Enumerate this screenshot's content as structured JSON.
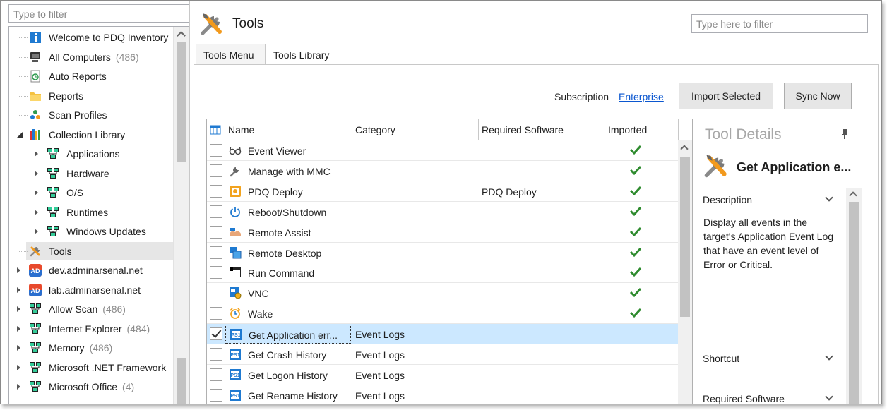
{
  "left_panel": {
    "filter_placeholder": "Type to filter",
    "tree": [
      {
        "label": "Welcome to PDQ Inventory",
        "count": "",
        "icon": "info-icon",
        "level": 1,
        "expander": ""
      },
      {
        "label": "All Computers",
        "count": "(486)",
        "icon": "computer-icon",
        "level": 1,
        "expander": ""
      },
      {
        "label": "Auto Reports",
        "count": "",
        "icon": "auto-report-icon",
        "level": 1,
        "expander": ""
      },
      {
        "label": "Reports",
        "count": "",
        "icon": "folder-icon",
        "level": 1,
        "expander": ""
      },
      {
        "label": "Scan Profiles",
        "count": "",
        "icon": "scan-profiles-icon",
        "level": 1,
        "expander": ""
      },
      {
        "label": "Collection Library",
        "count": "",
        "icon": "library-icon",
        "level": 1,
        "expander": "open"
      },
      {
        "label": "Applications",
        "count": "",
        "icon": "collection-icon",
        "level": 2,
        "expander": "closed"
      },
      {
        "label": "Hardware",
        "count": "",
        "icon": "collection-icon",
        "level": 2,
        "expander": "closed"
      },
      {
        "label": "O/S",
        "count": "",
        "icon": "collection-icon",
        "level": 2,
        "expander": "closed"
      },
      {
        "label": "Runtimes",
        "count": "",
        "icon": "collection-icon",
        "level": 2,
        "expander": "closed"
      },
      {
        "label": "Windows Updates",
        "count": "",
        "icon": "collection-icon",
        "level": 2,
        "expander": "closed"
      },
      {
        "label": "Tools",
        "count": "",
        "icon": "tools-icon",
        "level": 1,
        "expander": "",
        "selected": true
      },
      {
        "label": "dev.adminarsenal.net",
        "count": "",
        "icon": "ad-icon",
        "level": 1,
        "expander": "closed"
      },
      {
        "label": "lab.adminarsenal.net",
        "count": "",
        "icon": "ad-icon",
        "level": 1,
        "expander": "closed"
      },
      {
        "label": "Allow Scan",
        "count": "(486)",
        "icon": "collection-icon",
        "level": 1,
        "expander": "closed"
      },
      {
        "label": "Internet Explorer",
        "count": "(484)",
        "icon": "collection-icon",
        "level": 1,
        "expander": "closed"
      },
      {
        "label": "Memory",
        "count": "(486)",
        "icon": "collection-icon",
        "level": 1,
        "expander": "closed"
      },
      {
        "label": "Microsoft .NET Framework",
        "count": "",
        "icon": "collection-icon",
        "level": 1,
        "expander": "closed"
      },
      {
        "label": "Microsoft Office",
        "count": "(4)",
        "icon": "collection-icon",
        "level": 1,
        "expander": "closed"
      }
    ]
  },
  "header": {
    "title": "Tools",
    "filter_placeholder": "Type here to filter"
  },
  "tabs": [
    {
      "label": "Tools Menu",
      "active": false
    },
    {
      "label": "Tools Library",
      "active": true
    }
  ],
  "subscription": {
    "label": "Subscription",
    "value": "Enterprise"
  },
  "buttons": {
    "import_selected": "Import Selected",
    "sync_now": "Sync Now"
  },
  "grid": {
    "columns": [
      "Name",
      "Category",
      "Required Software",
      "Imported"
    ],
    "rows": [
      {
        "checked": false,
        "icon": "glasses-icon",
        "name": "Event Viewer",
        "category": "",
        "required": "",
        "imported": true
      },
      {
        "checked": false,
        "icon": "wrench-icon",
        "name": "Manage with MMC",
        "category": "",
        "required": "",
        "imported": true
      },
      {
        "checked": false,
        "icon": "pdq-deploy-icon",
        "name": "PDQ Deploy",
        "category": "",
        "required": "PDQ Deploy",
        "imported": true
      },
      {
        "checked": false,
        "icon": "power-icon",
        "name": "Reboot/Shutdown",
        "category": "",
        "required": "",
        "imported": true
      },
      {
        "checked": false,
        "icon": "remote-assist-icon",
        "name": "Remote Assist",
        "category": "",
        "required": "",
        "imported": true
      },
      {
        "checked": false,
        "icon": "remote-desktop-icon",
        "name": "Remote Desktop",
        "category": "",
        "required": "",
        "imported": true
      },
      {
        "checked": false,
        "icon": "console-icon",
        "name": "Run Command",
        "category": "",
        "required": "",
        "imported": true
      },
      {
        "checked": false,
        "icon": "vnc-icon",
        "name": "VNC",
        "category": "",
        "required": "",
        "imported": true
      },
      {
        "checked": false,
        "icon": "alarm-clock-icon",
        "name": "Wake",
        "category": "",
        "required": "",
        "imported": true
      },
      {
        "checked": true,
        "icon": "powershell-icon",
        "name": "Get Application err...",
        "category": "Event Logs",
        "required": "",
        "imported": false,
        "selected": true
      },
      {
        "checked": false,
        "icon": "powershell-icon",
        "name": "Get Crash History",
        "category": "Event Logs",
        "required": "",
        "imported": false
      },
      {
        "checked": false,
        "icon": "powershell-icon",
        "name": "Get Logon History",
        "category": "Event Logs",
        "required": "",
        "imported": false
      },
      {
        "checked": false,
        "icon": "powershell-icon",
        "name": "Get Rename History",
        "category": "Event Logs",
        "required": "",
        "imported": false
      }
    ]
  },
  "details": {
    "title": "Tool Details",
    "tool_name": "Get Application e...",
    "sections": [
      "Description",
      "Shortcut",
      "Required Software"
    ],
    "description": "Display all events in the target's Application Event Log that have an event level of Error or Critical."
  },
  "colors": {
    "selection": "#cce8ff",
    "check_green": "#2e8b2e",
    "link": "#0b57d0",
    "powershell_blue": "#1f7ad1"
  }
}
